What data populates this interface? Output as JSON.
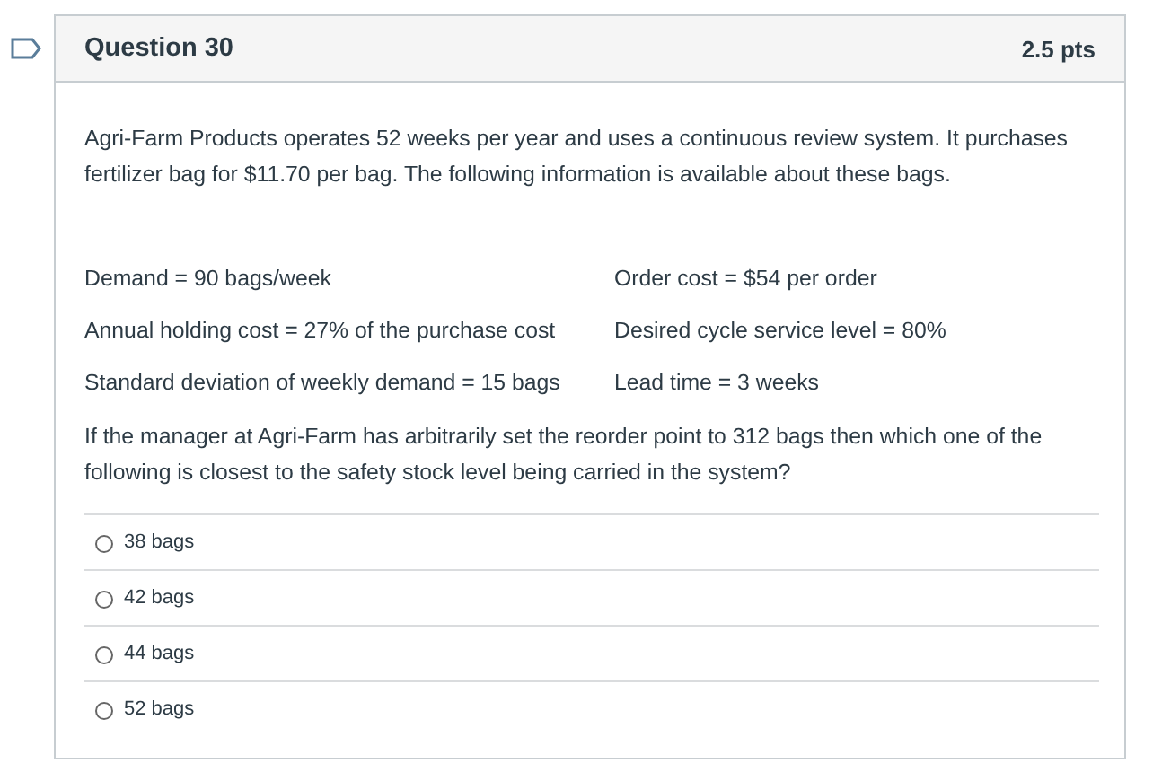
{
  "question": {
    "title": "Question 30",
    "points": "2.5 pts",
    "bookmarked": false,
    "intro": "Agri-Farm Products operates 52 weeks per year and uses a continuous review system.  It purchases fertilizer bag for $11.70 per bag.  The following information is available about these bags.",
    "facts": [
      [
        "Demand = 90 bags/week",
        "Order cost = $54 per order"
      ],
      [
        "Annual holding cost = 27% of the purchase cost",
        "Desired cycle service level = 80%"
      ],
      [
        "Standard deviation of weekly demand = 15 bags",
        "Lead time = 3 weeks"
      ]
    ],
    "prompt": "If the manager at Agri-Farm has arbitrarily set the reorder point to 312 bags then which one of the following is closest to the safety stock level being carried in the system?",
    "answers": [
      {
        "label": "38 bags",
        "selected": false
      },
      {
        "label": "42 bags",
        "selected": false
      },
      {
        "label": "44 bags",
        "selected": false
      },
      {
        "label": "52 bags",
        "selected": false
      }
    ]
  }
}
